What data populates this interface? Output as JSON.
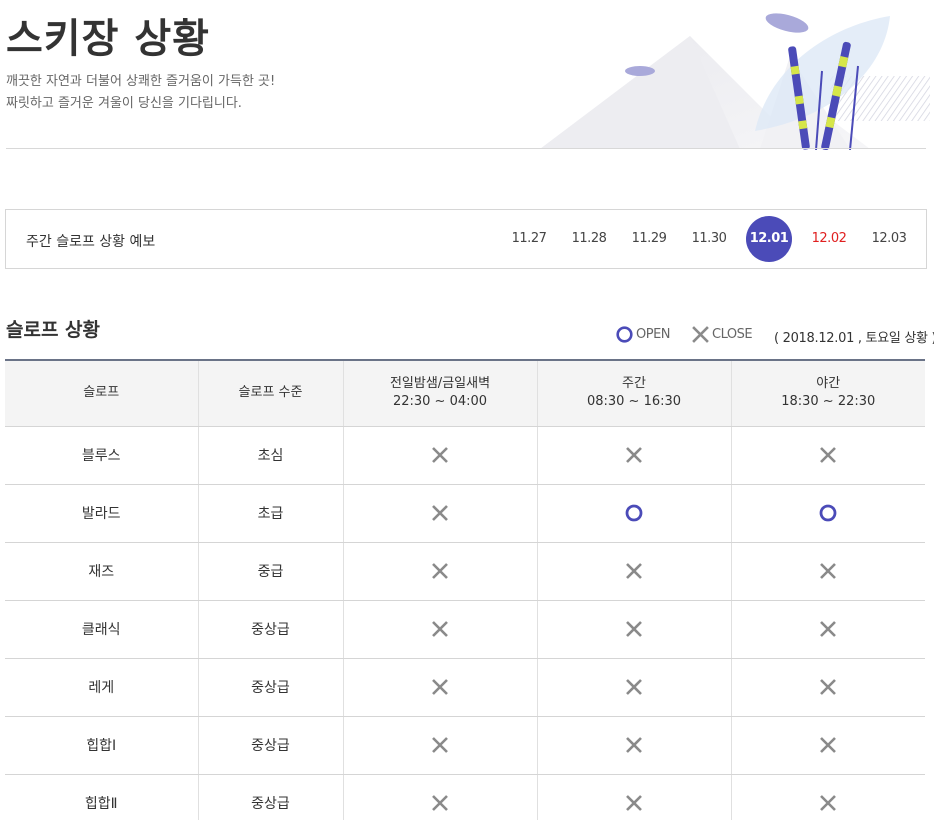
{
  "header": {
    "title": "스키장 상황",
    "subtitle_lines": [
      "깨끗한 자연과 더불어 상쾌한 즐거움이 가득한 곳!",
      "짜릿하고 즐거운 겨울이 당신을 기다립니다."
    ]
  },
  "forecast": {
    "label": "주간 슬로프 상황 예보",
    "dates": [
      {
        "label": "11.27",
        "state": "normal"
      },
      {
        "label": "11.28",
        "state": "normal"
      },
      {
        "label": "11.29",
        "state": "normal"
      },
      {
        "label": "11.30",
        "state": "normal"
      },
      {
        "label": "12.01",
        "state": "active"
      },
      {
        "label": "12.02",
        "state": "weekend"
      },
      {
        "label": "12.03",
        "state": "normal"
      }
    ]
  },
  "status": {
    "heading": "슬로프 상황",
    "legend_open": "OPEN",
    "legend_close": "CLOSE",
    "date_text": "( 2018.12.01 , 토요일 상황 )"
  },
  "table": {
    "headers": {
      "slope": "슬로프",
      "level": "슬로프 수준",
      "late_night_title": "전일밤샘/금일새벽",
      "late_night_time": "22:30 ~ 04:00",
      "day_title": "주간",
      "day_time": "08:30 ~ 16:30",
      "night_title": "야간",
      "night_time": "18:30 ~ 22:30"
    },
    "rows": [
      {
        "slope": "블루스",
        "level": "초심",
        "late_night": "close",
        "day": "close",
        "night": "close"
      },
      {
        "slope": "발라드",
        "level": "초급",
        "late_night": "close",
        "day": "open",
        "night": "open"
      },
      {
        "slope": "재즈",
        "level": "중급",
        "late_night": "close",
        "day": "close",
        "night": "close"
      },
      {
        "slope": "클래식",
        "level": "중상급",
        "late_night": "close",
        "day": "close",
        "night": "close"
      },
      {
        "slope": "레게",
        "level": "중상급",
        "late_night": "close",
        "day": "close",
        "night": "close"
      },
      {
        "slope": "힙합Ⅰ",
        "level": "중상급",
        "late_night": "close",
        "day": "close",
        "night": "close"
      },
      {
        "slope": "힙합Ⅱ",
        "level": "중상급",
        "late_night": "close",
        "day": "close",
        "night": "close"
      }
    ]
  },
  "colors": {
    "accent": "#4b4bb8",
    "weekend": "#e02020",
    "close_mark": "#8a8a8a",
    "header_border": "#6a7387"
  }
}
